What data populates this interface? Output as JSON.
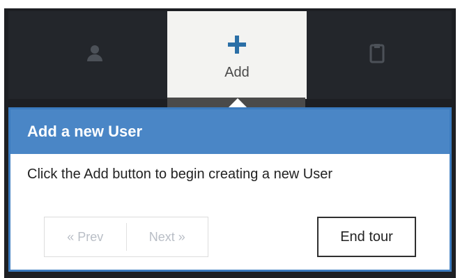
{
  "toolbar": {
    "items": [
      {
        "label": "",
        "icon": "user-icon"
      },
      {
        "label": "Add",
        "icon": "plus-icon"
      },
      {
        "label": "",
        "icon": "clipboard-icon"
      }
    ]
  },
  "popover": {
    "title": "Add a new User",
    "content": "Click the Add button to begin creating a new User",
    "buttons": {
      "prev": "« Prev",
      "next": "Next »",
      "end": "End tour"
    }
  },
  "colors": {
    "header": "#4a86c6",
    "border": "#3b7bbf",
    "plus": "#2b6fa6"
  }
}
